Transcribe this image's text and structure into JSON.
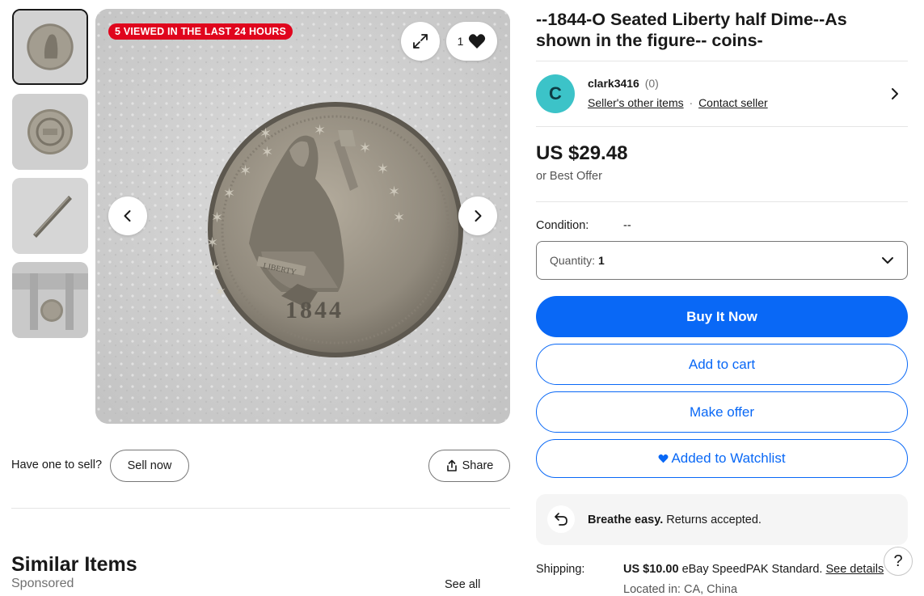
{
  "gallery": {
    "badge": "5 VIEWED IN THE LAST 24 HOURS",
    "watch_count": "1",
    "thumbnails": [
      "coin-obverse",
      "coin-reverse",
      "coin-edge",
      "coin-caliper"
    ],
    "coin_date": "1844",
    "coin_legend": "LIBERTY"
  },
  "sell": {
    "prompt": "Have one to sell?",
    "sell_now_label": "Sell now",
    "share_label": "Share"
  },
  "similar": {
    "heading": "Similar Items",
    "sponsored": "Sponsored",
    "see_all": "See all"
  },
  "item": {
    "title": "--1844-O Seated Liberty half Dime--As shown in the figure-- coins-"
  },
  "seller": {
    "avatar_letter": "C",
    "name": "clark3416",
    "feedback": "(0)",
    "other_items": "Seller's other items",
    "separator": "·",
    "contact": "Contact seller"
  },
  "price": {
    "amount": "US $29.48",
    "offer_note": "or Best Offer"
  },
  "condition": {
    "label": "Condition:",
    "value": "--"
  },
  "quantity": {
    "label": "Quantity:",
    "value": "1"
  },
  "actions": {
    "buy_now": "Buy It Now",
    "add_to_cart": "Add to cart",
    "make_offer": "Make offer",
    "watchlist": "Added to Watchlist"
  },
  "returns": {
    "bold": "Breathe easy.",
    "text": "Returns accepted."
  },
  "shipping": {
    "label": "Shipping:",
    "price": "US $10.00",
    "service": "eBay SpeedPAK Standard.",
    "details": "See details",
    "location_partial": "Located in: CA, China"
  },
  "help_label": "?",
  "colors": {
    "primary_blue": "#0968f6",
    "badge_red": "#e0051d",
    "avatar_teal": "#3cc3c8"
  }
}
